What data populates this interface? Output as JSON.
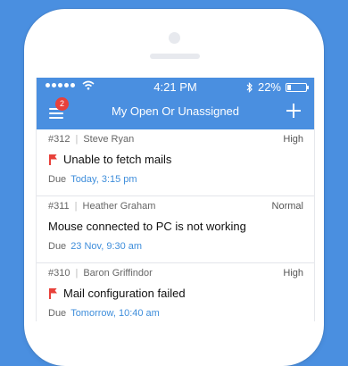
{
  "status_bar": {
    "time": "4:21 PM",
    "battery": "22%",
    "battery_level": 0.22
  },
  "nav": {
    "title": "My Open Or Unassigned",
    "menu_badge": "2"
  },
  "tickets": [
    {
      "id": "#312",
      "requester": "Steve Ryan",
      "priority": "High",
      "subject": "Unable to fetch mails",
      "flagged": true,
      "due_label": "Due",
      "due_value": "Today, 3:15 pm"
    },
    {
      "id": "#311",
      "requester": "Heather Graham",
      "priority": "Normal",
      "subject": "Mouse connected to PC is not working",
      "flagged": false,
      "due_label": "Due",
      "due_value": "23 Nov, 9:30 am"
    },
    {
      "id": "#310",
      "requester": "Baron Griffindor",
      "priority": "High",
      "subject": "Mail configuration failed",
      "flagged": true,
      "due_label": "Due",
      "due_value": "Tomorrow, 10:40 am"
    }
  ],
  "colors": {
    "brand": "#4a8fe0",
    "flag": "#e8413a",
    "due_value": "#3f8edb"
  }
}
